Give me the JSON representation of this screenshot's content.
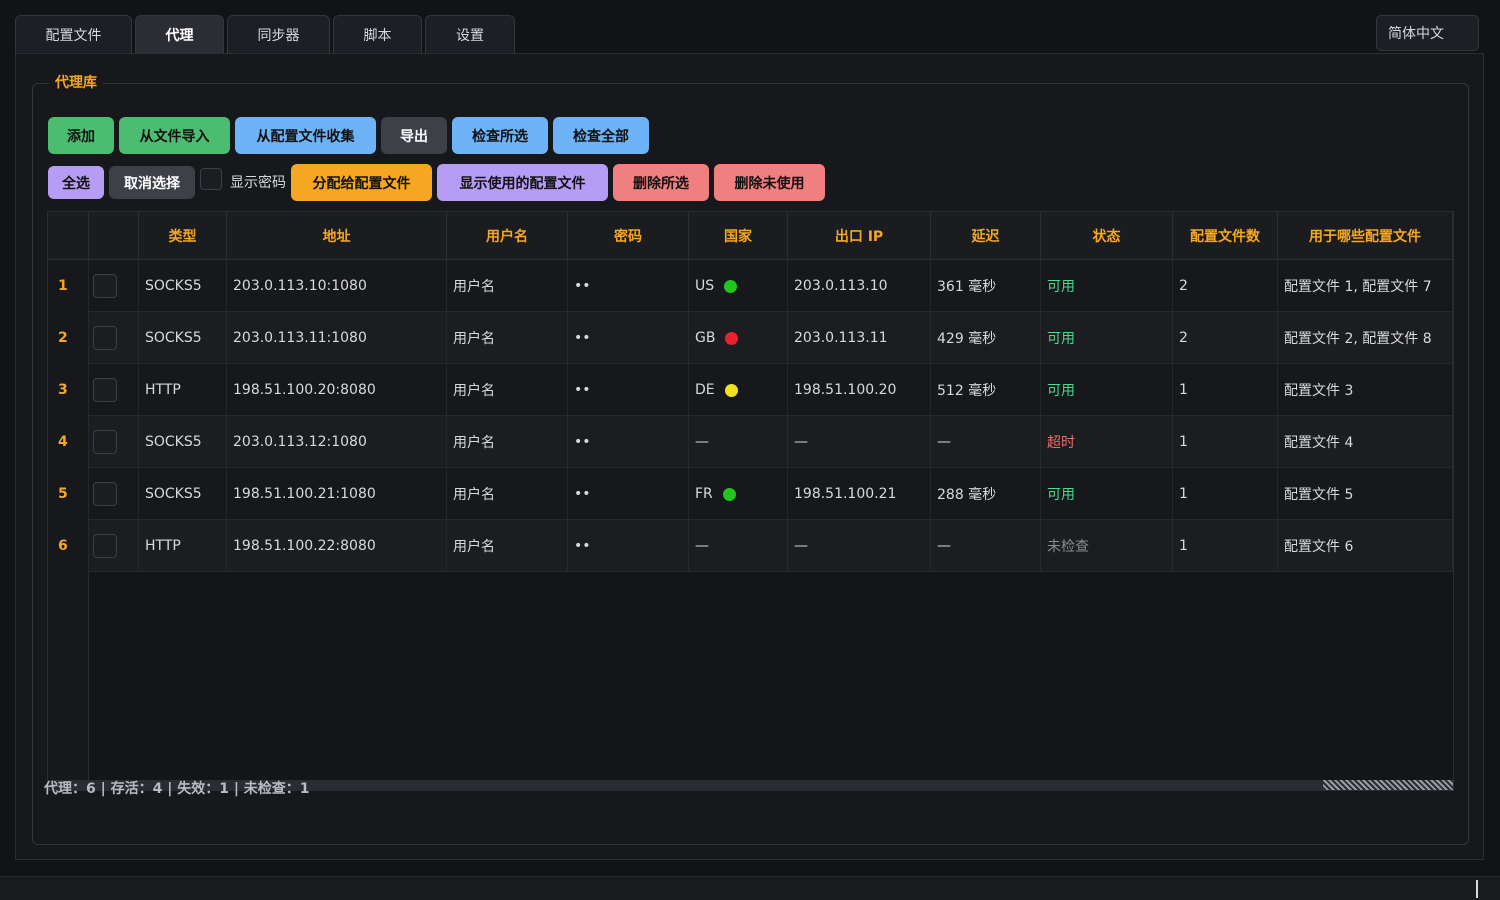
{
  "tabs": [
    "配置文件",
    "代理",
    "同步器",
    "脚本",
    "设置"
  ],
  "active_tab": "代理",
  "language": "简体中文",
  "group_title": "代理库",
  "buttons_row1": [
    {
      "label": "添加",
      "color": "green"
    },
    {
      "label": "从文件导入",
      "color": "green"
    },
    {
      "label": "从配置文件收集",
      "color": "blue"
    },
    {
      "label": "导出",
      "color": "gray"
    },
    {
      "label": "检查所选",
      "color": "blue"
    },
    {
      "label": "检查全部",
      "color": "blue"
    }
  ],
  "buttons_row2": {
    "select_all": "全选",
    "deselect": "取消选择",
    "show_password": "显示密码",
    "assign": "分配给配置文件",
    "show_used": "显示使用的配置文件",
    "delete_selected": "删除所选",
    "delete_unused": "删除未使用"
  },
  "columns": [
    "",
    "",
    "类型",
    "地址",
    "用户名",
    "密码",
    "国家",
    "出口 IP",
    "延迟",
    "状态",
    "配置文件数",
    "用于哪些配置文件"
  ],
  "rows": [
    {
      "num": "1",
      "type": "SOCKS5",
      "address": "203.0.113.10:1080",
      "username": "用户名",
      "password": "••",
      "country": "US",
      "country_dot": "#22c41e",
      "exit_ip": "203.0.113.10",
      "latency": "361 毫秒",
      "status": "可用",
      "status_kind": "ok",
      "profile_count": "2",
      "profiles": "配置文件 1, 配置文件 7"
    },
    {
      "num": "2",
      "type": "SOCKS5",
      "address": "203.0.113.11:1080",
      "username": "用户名",
      "password": "••",
      "country": "GB",
      "country_dot": "#e8212e",
      "exit_ip": "203.0.113.11",
      "latency": "429 毫秒",
      "status": "可用",
      "status_kind": "ok",
      "profile_count": "2",
      "profiles": "配置文件 2, 配置文件 8"
    },
    {
      "num": "3",
      "type": "HTTP",
      "address": "198.51.100.20:8080",
      "username": "用户名",
      "password": "••",
      "country": "DE",
      "country_dot": "#f1e21b",
      "exit_ip": "198.51.100.20",
      "latency": "512 毫秒",
      "status": "可用",
      "status_kind": "ok",
      "profile_count": "1",
      "profiles": "配置文件 3"
    },
    {
      "num": "4",
      "type": "SOCKS5",
      "address": "203.0.113.12:1080",
      "username": "用户名",
      "password": "••",
      "country": "—",
      "country_dot": "",
      "exit_ip": "—",
      "latency": "—",
      "status": "超时",
      "status_kind": "bad",
      "profile_count": "1",
      "profiles": "配置文件 4"
    },
    {
      "num": "5",
      "type": "SOCKS5",
      "address": "198.51.100.21:1080",
      "username": "用户名",
      "password": "••",
      "country": "FR",
      "country_dot": "#22c41e",
      "exit_ip": "198.51.100.21",
      "latency": "288 毫秒",
      "status": "可用",
      "status_kind": "ok",
      "profile_count": "1",
      "profiles": "配置文件 5"
    },
    {
      "num": "6",
      "type": "HTTP",
      "address": "198.51.100.22:8080",
      "username": "用户名",
      "password": "••",
      "country": "—",
      "country_dot": "",
      "exit_ip": "—",
      "latency": "—",
      "status": "未检查",
      "status_kind": "none",
      "profile_count": "1",
      "profiles": "配置文件 6"
    }
  ],
  "stats": "代理：6 | 存活：4 | 失效：1 | 未检查：1",
  "colors": {
    "accent": "#f5a623",
    "green_btn": "#4cbc70",
    "blue_btn": "#6db3f5",
    "purple_btn": "#b79cf5",
    "red_btn": "#f07f7f",
    "status_ok": "#4cd98b",
    "status_bad": "#ef6b6b"
  }
}
